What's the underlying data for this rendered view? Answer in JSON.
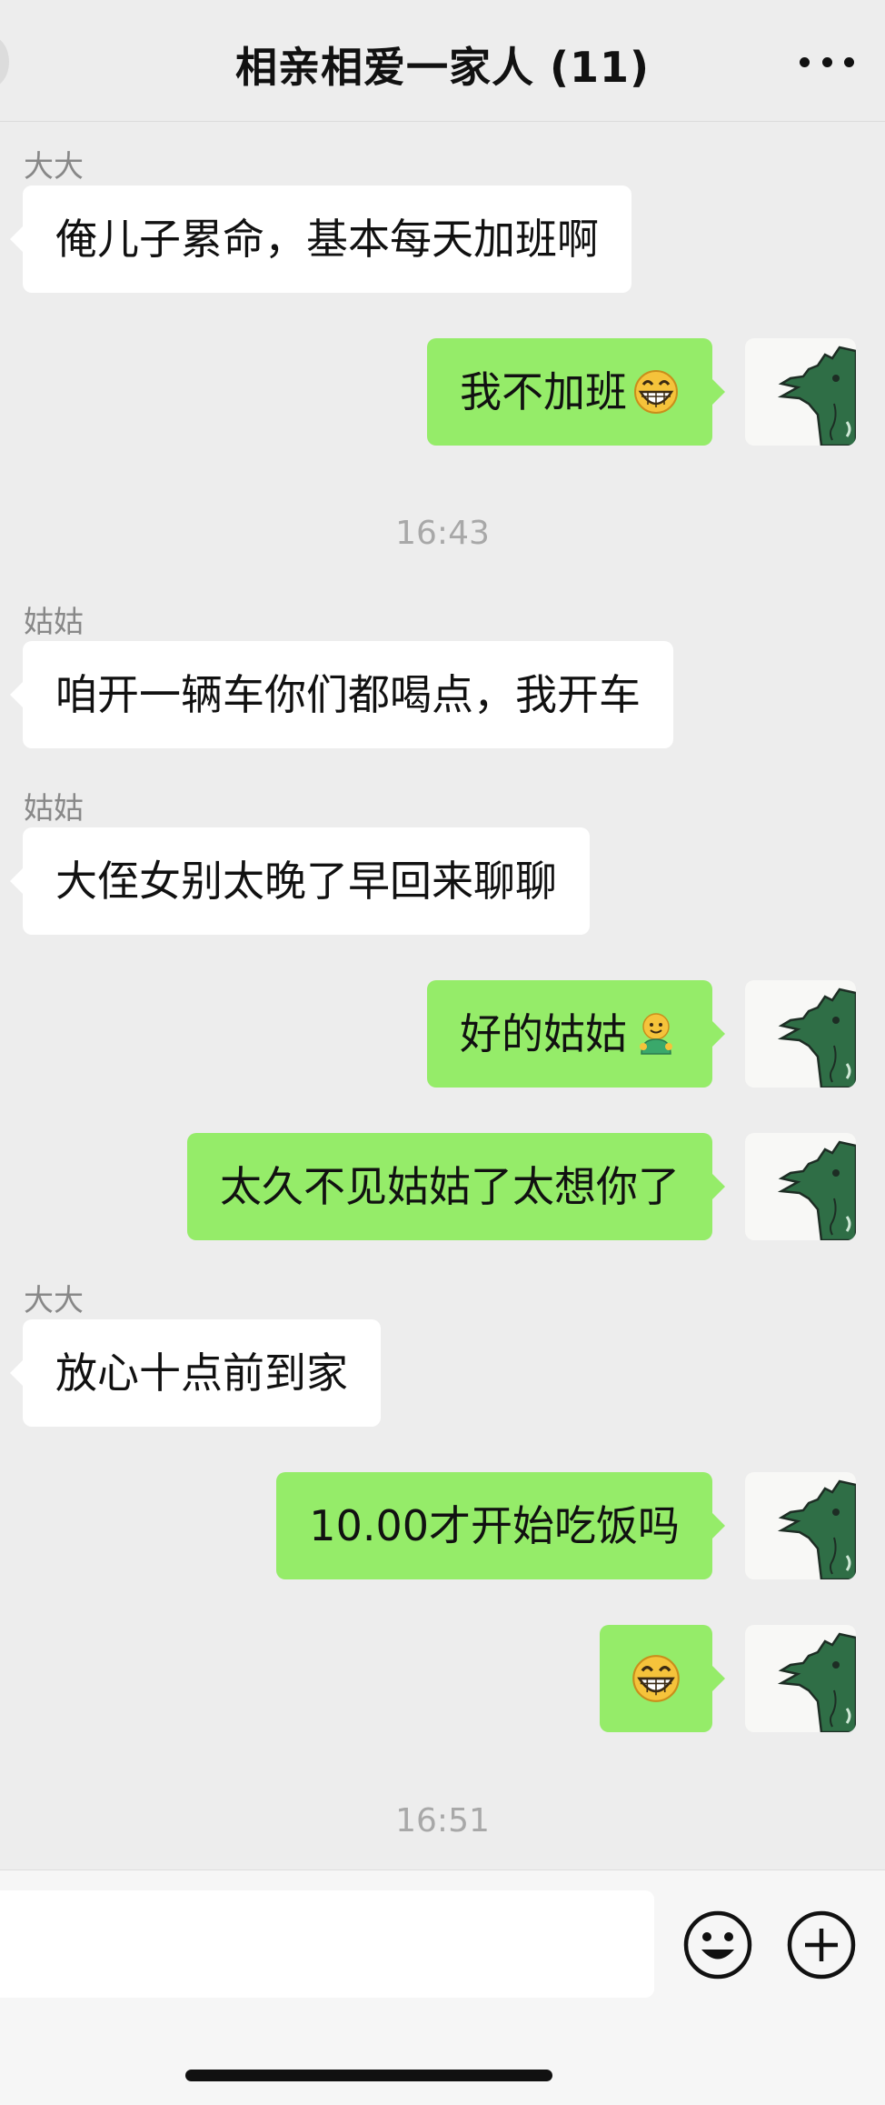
{
  "header": {
    "title": "相亲相爱一家人 (11)"
  },
  "messages": {
    "m1": {
      "sender": "大大",
      "text": "俺儿子累命，基本每天加班啊"
    },
    "m2": {
      "text": "我不加班"
    },
    "t1": "16:43",
    "m3": {
      "sender": "姑姑",
      "text": "咱开一辆车你们都喝点，我开车"
    },
    "m4": {
      "sender": "姑姑",
      "text": "大侄女别太晚了早回来聊聊"
    },
    "m5": {
      "text": "好的姑姑"
    },
    "m6": {
      "text": "太久不见姑姑了太想你了"
    },
    "m7": {
      "sender": "大大",
      "text": "放心十点前到家"
    },
    "m8": {
      "text": "10.00才开始吃饭吗"
    },
    "t2": "16:51"
  },
  "icons": {
    "more": "more-dots-icon",
    "avatar": "crocodile-avatar",
    "grin": "grin-emoji",
    "smile": "smile-emoji",
    "emoji_button": "emoji-face-icon",
    "plus_button": "plus-circle-icon"
  },
  "colors": {
    "background": "#ededed",
    "outgoing": "#95ec69",
    "incoming": "#ffffff"
  }
}
